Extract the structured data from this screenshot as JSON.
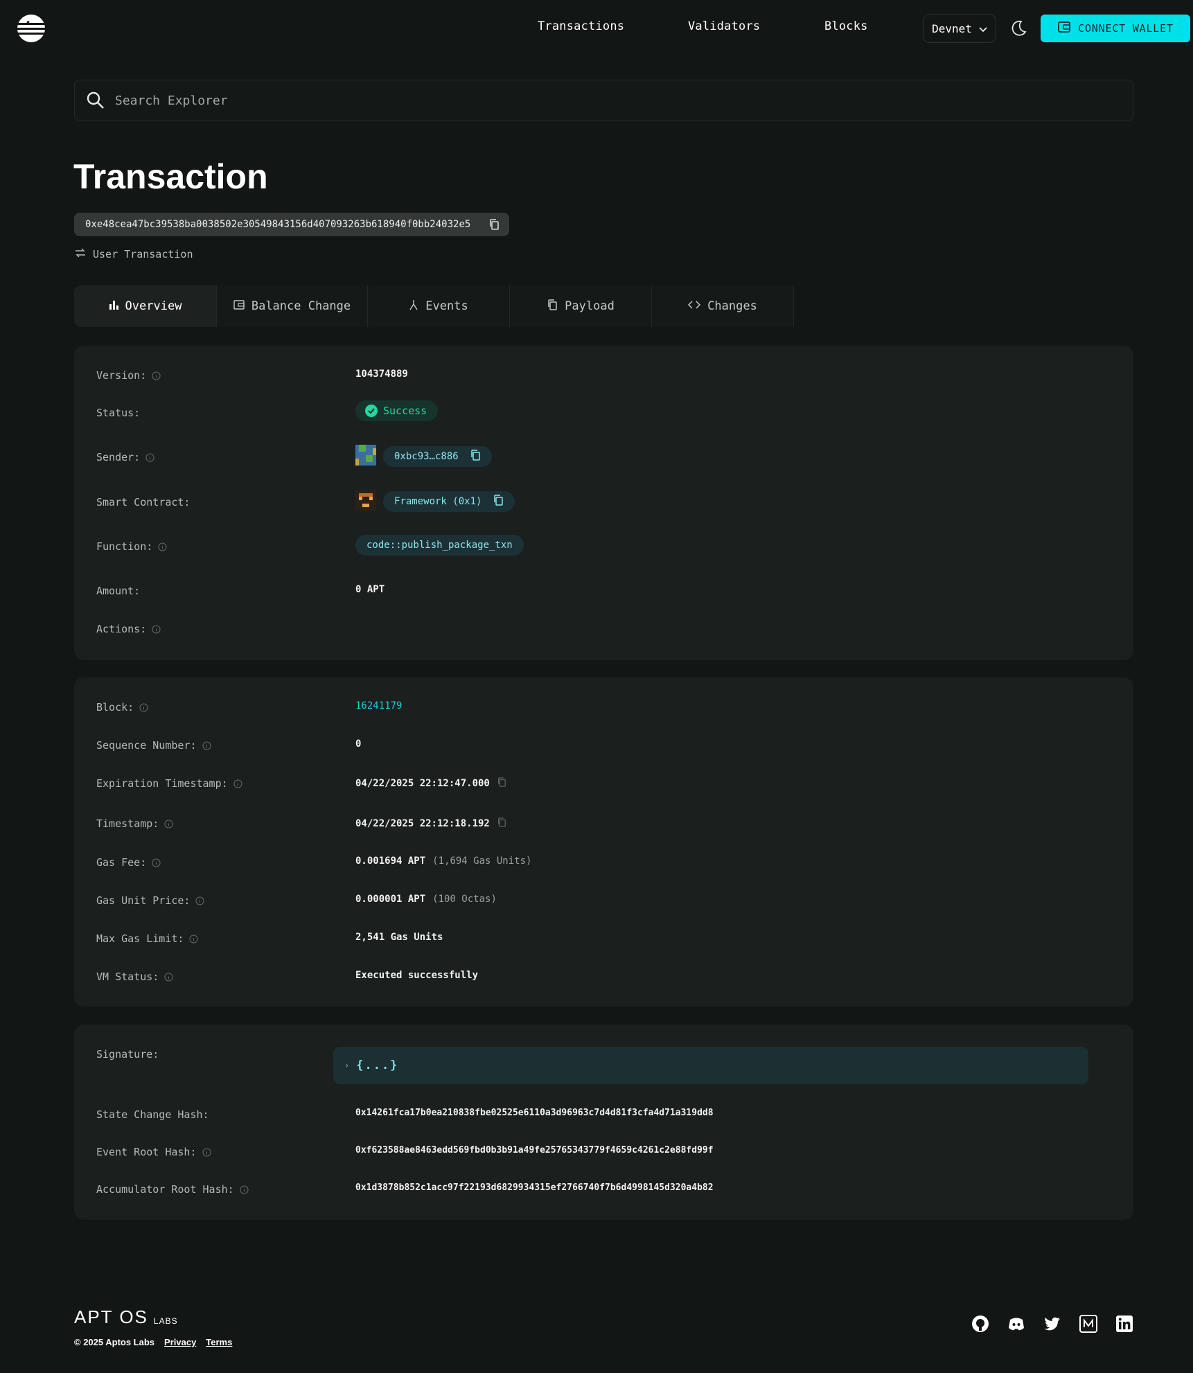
{
  "nav": {
    "links": [
      "Transactions",
      "Validators",
      "Blocks"
    ],
    "network": "Devnet",
    "connect_label": "CONNECT WALLET"
  },
  "search": {
    "placeholder": "Search Explorer"
  },
  "page": {
    "title": "Transaction",
    "hash": "0xe48cea47bc39538ba0038502e30549843156d407093263b618940f0bb24032e5",
    "type": "User Transaction"
  },
  "tabs": [
    "Overview",
    "Balance Change",
    "Events",
    "Payload",
    "Changes"
  ],
  "overview": {
    "version_label": "Version:",
    "version": "104374889",
    "status_label": "Status:",
    "status": "Success",
    "sender_label": "Sender:",
    "sender": "0xbc93…c886",
    "contract_label": "Smart Contract:",
    "contract": "Framework (0x1)",
    "function_label": "Function:",
    "function": "code::publish_package_txn",
    "amount_label": "Amount:",
    "amount": "0 APT",
    "actions_label": "Actions:"
  },
  "details": {
    "block_label": "Block:",
    "block": "16241179",
    "seq_label": "Sequence Number:",
    "seq": "0",
    "exp_label": "Expiration Timestamp:",
    "exp": "04/22/2025 22:12:47.000",
    "ts_label": "Timestamp:",
    "ts": "04/22/2025 22:12:18.192",
    "gas_fee_label": "Gas Fee:",
    "gas_fee": "0.001694 APT",
    "gas_fee_units": "(1,694 Gas Units)",
    "gas_price_label": "Gas Unit Price:",
    "gas_price": "0.000001 APT",
    "gas_price_octas": "(100 Octas)",
    "max_gas_label": "Max Gas Limit:",
    "max_gas": "2,541 Gas Units",
    "vm_label": "VM Status:",
    "vm": "Executed successfully"
  },
  "hashes": {
    "sig_label": "Signature:",
    "sig": "{...}",
    "state_label": "State Change Hash:",
    "state": "0x14261fca17b0ea210838fbe02525e6110a3d96963c7d4d81f3cfa4d71a319dd8",
    "event_label": "Event Root Hash:",
    "event": "0xf623588ae8463edd569fbd0b3b91a49fe25765343779f4659c4261c2e88fd99f",
    "acc_label": "Accumulator Root Hash:",
    "acc": "0x1d3878b852c1acc97f22193d6829934315ef2766740f7b6d4998145d320a4b82"
  },
  "footer": {
    "brand": "APT OS",
    "labs": "LABS",
    "copyright": "© 2025 Aptos Labs",
    "privacy": "Privacy",
    "terms": "Terms"
  },
  "colors": {
    "accent": "#00e0e8",
    "success": "#28d7a0",
    "link": "#14d3dd"
  },
  "icons": [
    "aptos-logo-icon",
    "chevron-down-icon",
    "moon-icon",
    "wallet-icon",
    "search-icon",
    "copy-icon",
    "transfer-icon",
    "bar-chart-icon",
    "balance-icon",
    "events-icon",
    "payload-icon",
    "code-icon",
    "info-icon",
    "check-circle-icon",
    "github-icon",
    "discord-icon",
    "twitter-icon",
    "medium-icon",
    "linkedin-icon"
  ]
}
